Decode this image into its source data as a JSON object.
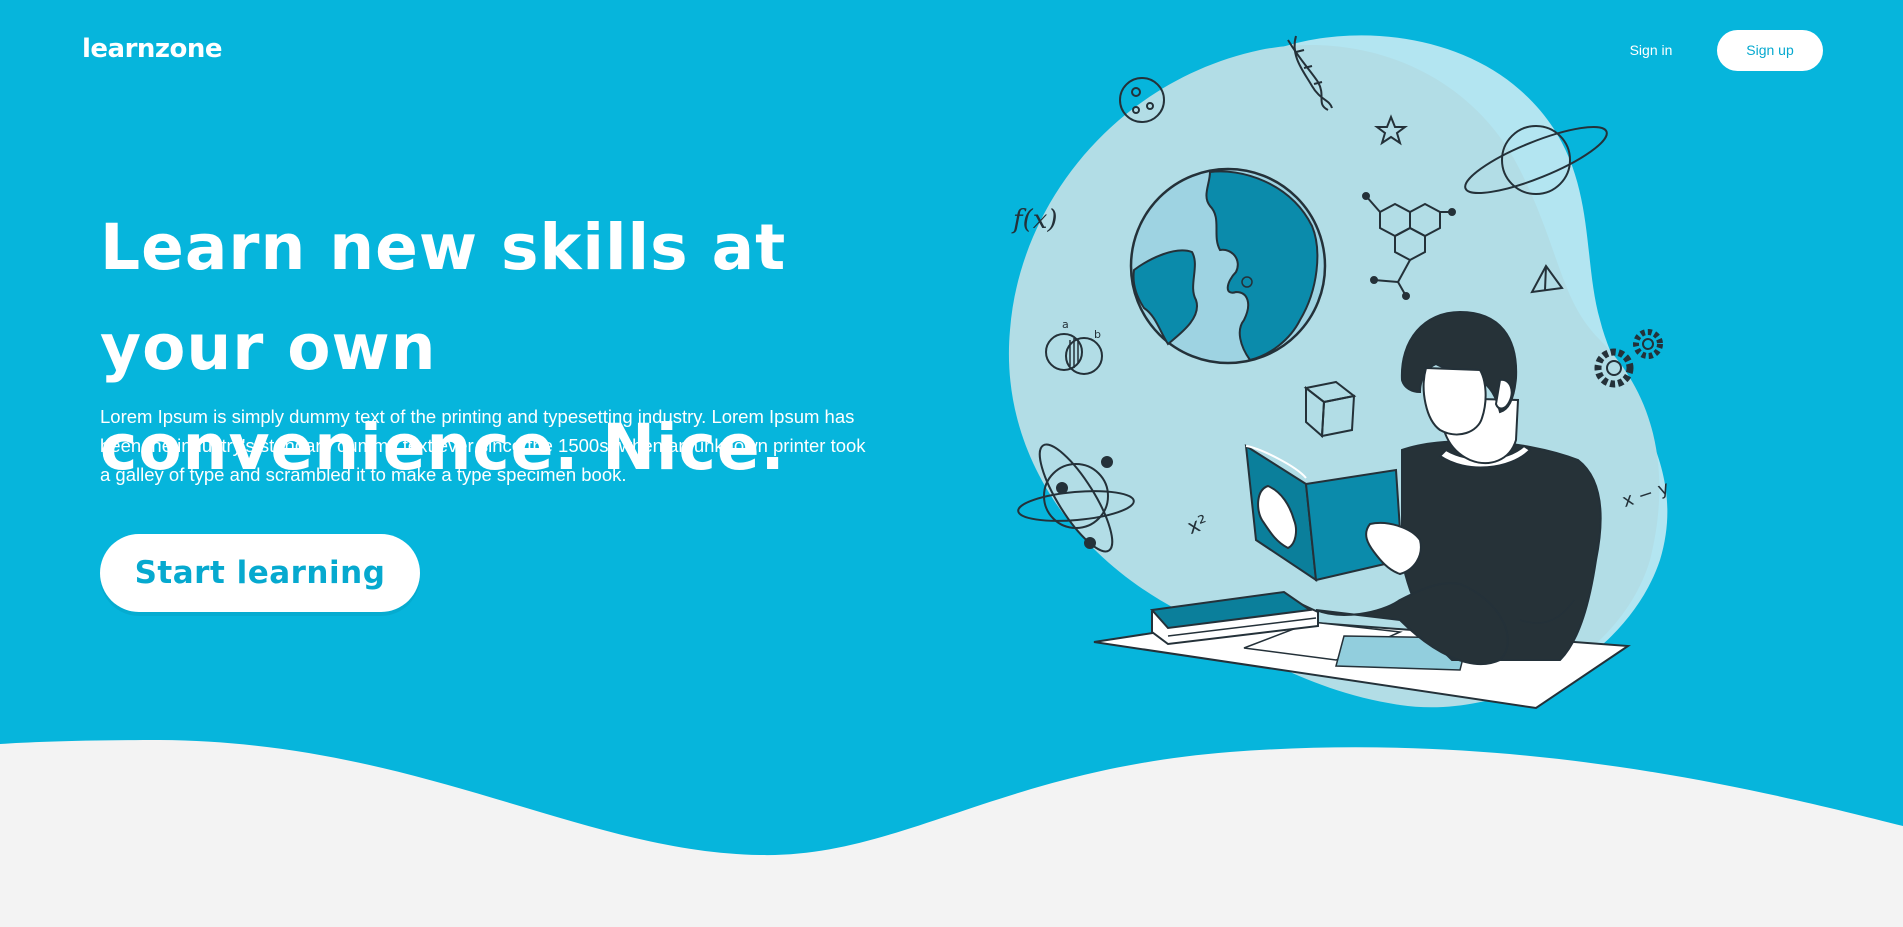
{
  "header": {
    "logo": "learnzone",
    "sign_in": "Sign in",
    "sign_up": "Sign up"
  },
  "hero": {
    "headline": "Learn new skills at your own convenience. Nice.",
    "description": "Lorem Ipsum is simply dummy text of the printing and typesetting industry. Lorem Ipsum has been the industry's standard dummy text ever since the 1500s, when an unknown printer took a galley of type and scrambled it to make a type specimen book.",
    "cta": "Start learning"
  },
  "illustration": {
    "formula_function": "f(x)",
    "formula_subtract": "x − y",
    "formula_square": "x²",
    "venn_a": "a",
    "venn_b": "b"
  },
  "colors": {
    "brand": "#06b5dc",
    "accent_text": "#06a9cf",
    "footer_bg": "#f3f3f3"
  },
  "icons": [
    "globe-icon",
    "dna-icon",
    "planet-icon",
    "atom-icon",
    "gear-icon",
    "cube-icon",
    "molecule-icon",
    "star-icon",
    "moon-icon"
  ]
}
